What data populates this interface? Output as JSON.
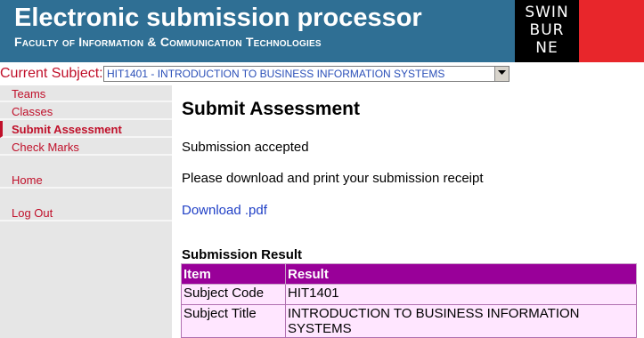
{
  "header": {
    "title": "Electronic submission processor",
    "subtitle": "Faculty of Information & Communication Technologies",
    "logo_lines": [
      "SWIN",
      "BUR",
      "NE"
    ]
  },
  "subject": {
    "label": "Current Subject:",
    "selected": "HIT1401 - INTRODUCTION TO BUSINESS INFORMATION SYSTEMS"
  },
  "sidebar": {
    "items": [
      {
        "label": "Teams"
      },
      {
        "label": "Classes"
      },
      {
        "label": "Submit Assessment"
      },
      {
        "label": "Check Marks"
      },
      {
        "label": "Home"
      },
      {
        "label": "Log Out"
      }
    ]
  },
  "main": {
    "title": "Submit Assessment",
    "status": "Submission accepted",
    "instruction": "Please download and print your submission receipt",
    "download_link": "Download .pdf",
    "result_heading": "Submission Result",
    "table": {
      "headers": [
        "Item",
        "Result"
      ],
      "rows": [
        [
          "Subject Code",
          "HIT1401"
        ],
        [
          "Subject Title",
          "INTRODUCTION TO BUSINESS INFORMATION SYSTEMS"
        ]
      ]
    }
  },
  "colors": {
    "header_bg": "#2f6f94",
    "accent_red": "#c0102a",
    "table_header": "#990099",
    "table_cell": "#ffe6ff",
    "link": "#1f3fc6"
  }
}
